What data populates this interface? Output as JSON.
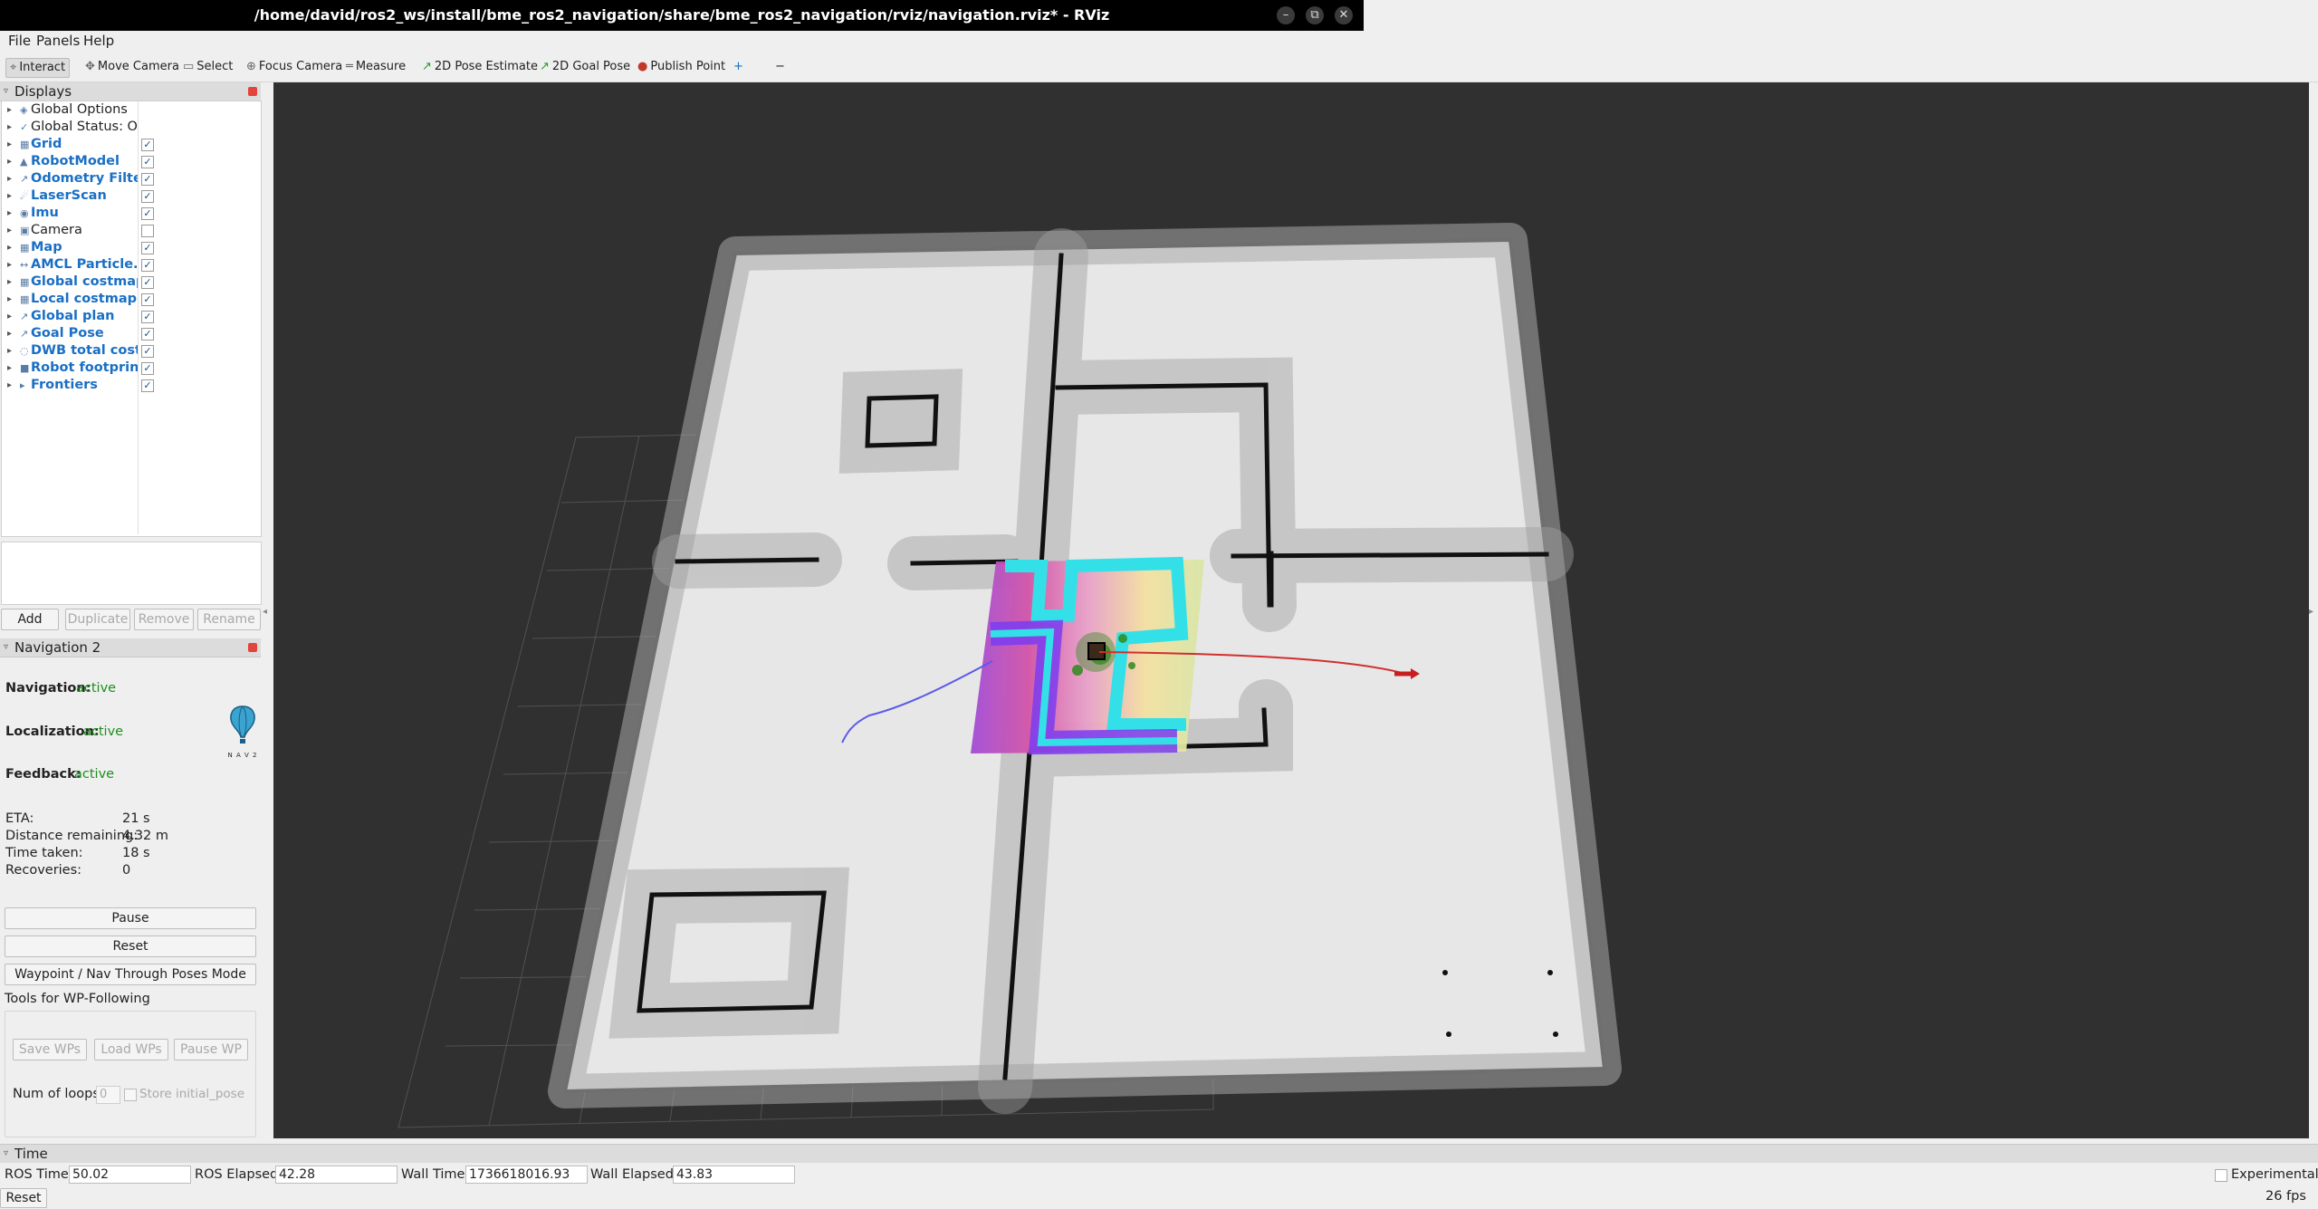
{
  "window": {
    "title": "/home/david/ros2_ws/install/bme_ros2_navigation/share/bme_ros2_navigation/rviz/navigation.rviz* - RViz"
  },
  "menu": {
    "file": "File",
    "panels": "Panels",
    "help": "Help"
  },
  "toolbar": {
    "interact": "Interact",
    "move_camera": "Move Camera",
    "select": "Select",
    "focus_camera": "Focus Camera",
    "measure": "Measure",
    "pose_estimate": "2D Pose Estimate",
    "goal_pose": "2D Goal Pose",
    "publish_point": "Publish Point",
    "plus": "+",
    "minus": "−"
  },
  "displays": {
    "title": "Displays",
    "items": [
      {
        "label": "Global Options",
        "bold": false,
        "checked": null
      },
      {
        "label": "Global Status: Ok",
        "bold": false,
        "checked": null
      },
      {
        "label": "Grid",
        "bold": true,
        "checked": true
      },
      {
        "label": "RobotModel",
        "bold": true,
        "checked": true
      },
      {
        "label": "Odometry Filte...",
        "bold": true,
        "checked": true
      },
      {
        "label": "LaserScan",
        "bold": true,
        "checked": true
      },
      {
        "label": "Imu",
        "bold": true,
        "checked": true
      },
      {
        "label": "Camera",
        "bold": false,
        "checked": false
      },
      {
        "label": "Map",
        "bold": true,
        "checked": true
      },
      {
        "label": "AMCL Particle...",
        "bold": true,
        "checked": true
      },
      {
        "label": "Global costmap",
        "bold": true,
        "checked": true
      },
      {
        "label": "Local costmap",
        "bold": true,
        "checked": true
      },
      {
        "label": "Global plan",
        "bold": true,
        "checked": true
      },
      {
        "label": "Goal Pose",
        "bold": true,
        "checked": true
      },
      {
        "label": "DWB total cost...",
        "bold": true,
        "checked": true
      },
      {
        "label": "Robot footprint",
        "bold": true,
        "checked": true
      },
      {
        "label": "Frontiers",
        "bold": true,
        "checked": true
      }
    ],
    "check_mark": "✓",
    "buttons": {
      "add": "Add",
      "duplicate": "Duplicate",
      "remove": "Remove",
      "rename": "Rename"
    }
  },
  "nav2": {
    "title": "Navigation 2",
    "navigation_label": "Navigation:",
    "navigation_value": "active",
    "localization_label": "Localization:",
    "localization_value": "active",
    "feedback_label": "Feedback:",
    "feedback_value": "active",
    "logo_text": "N A V 2",
    "eta_label": "ETA:",
    "eta_value": "21 s",
    "dist_label": "Distance remaining:",
    "dist_value": "4.32 m",
    "time_label": "Time taken:",
    "time_value": "18 s",
    "rec_label": "Recoveries:",
    "rec_value": "0",
    "pause": "Pause",
    "reset": "Reset",
    "waypoint_mode": "Waypoint / Nav Through Poses Mode",
    "wp_tools": "Tools for WP-Following",
    "save_wps": "Save WPs",
    "load_wps": "Load WPs",
    "pause_wp": "Pause WP",
    "num_loops_label": "Num of loops",
    "num_loops_value": "0",
    "store_initial": "Store initial_pose"
  },
  "time": {
    "title": "Time",
    "ros_time_label": "ROS Time:",
    "ros_time": "50.02",
    "ros_elapsed_label": "ROS Elapsed:",
    "ros_elapsed": "42.28",
    "wall_time_label": "Wall Time:",
    "wall_time": "1736618016.93",
    "wall_elapsed_label": "Wall Elapsed:",
    "wall_elapsed": "43.83",
    "experimental": "Experimental",
    "reset": "Reset",
    "fps": "26 fps"
  },
  "colors": {
    "viewport_bg": "#303030",
    "accent_blue": "#1a6fc4",
    "active_green": "#1c8f1c"
  }
}
